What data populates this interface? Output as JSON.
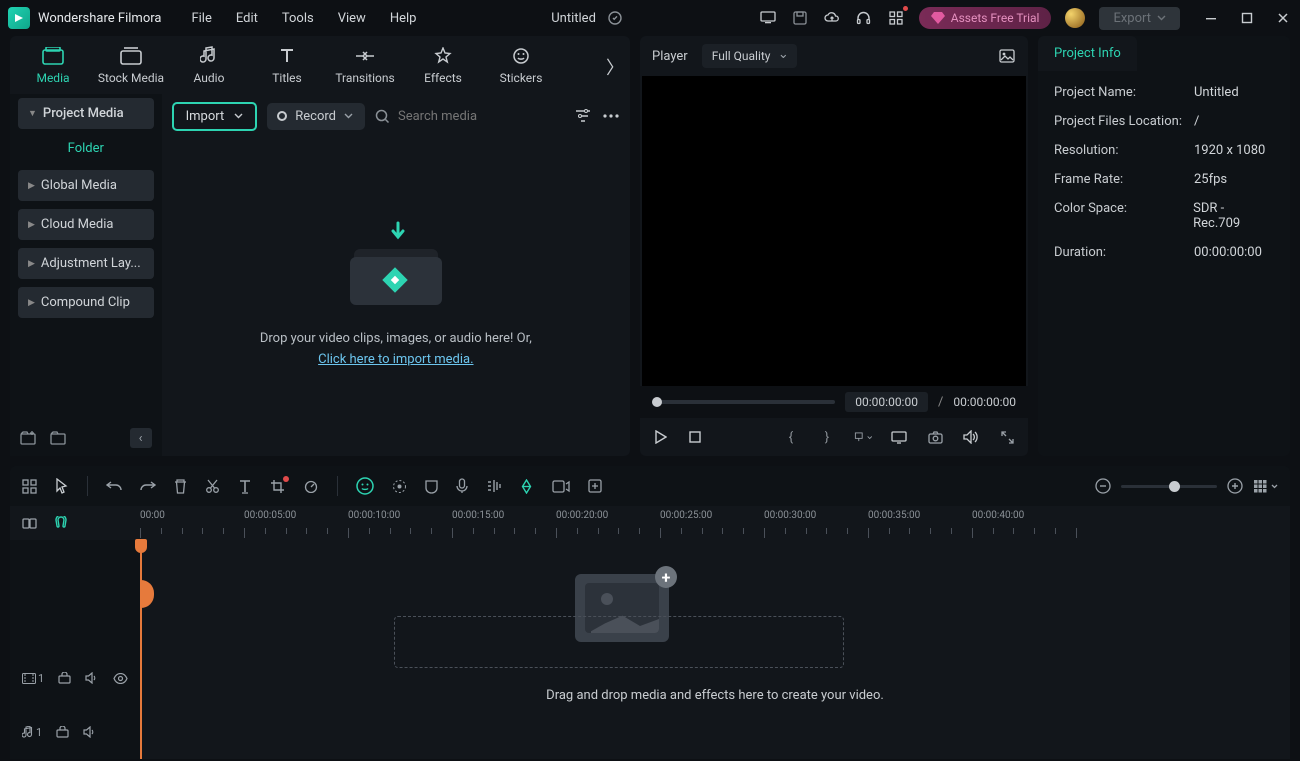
{
  "app": {
    "name": "Wondershare Filmora",
    "docTitle": "Untitled"
  },
  "menu": {
    "file": "File",
    "edit": "Edit",
    "tools": "Tools",
    "view": "View",
    "help": "Help"
  },
  "header": {
    "assets": "Assets Free Trial",
    "export": "Export"
  },
  "tabs": {
    "media": "Media",
    "stock": "Stock Media",
    "audio": "Audio",
    "titles": "Titles",
    "transitions": "Transitions",
    "effects": "Effects",
    "stickers": "Stickers"
  },
  "sidebar": {
    "projectMedia": "Project Media",
    "folder": "Folder",
    "items": [
      "Global Media",
      "Cloud Media",
      "Adjustment Lay...",
      "Compound Clip"
    ]
  },
  "mediaToolbar": {
    "import": "Import",
    "record": "Record",
    "searchPlaceholder": "Search media"
  },
  "dropzone": {
    "line1": "Drop your video clips, images, or audio here! Or,",
    "link": "Click here to import media."
  },
  "player": {
    "label": "Player",
    "quality": "Full Quality",
    "current": "00:00:00:00",
    "sep": "/",
    "total": "00:00:00:00"
  },
  "projectInfo": {
    "tab": "Project Info",
    "rows": [
      {
        "label": "Project Name:",
        "value": "Untitled"
      },
      {
        "label": "Project Files Location:",
        "value": "/"
      },
      {
        "label": "Resolution:",
        "value": "1920 x 1080"
      },
      {
        "label": "Frame Rate:",
        "value": "25fps"
      },
      {
        "label": "Color Space:",
        "value": "SDR - Rec.709"
      },
      {
        "label": "Duration:",
        "value": "00:00:00:00"
      }
    ]
  },
  "timeline": {
    "ruler": [
      "00:00",
      "00:00:05:00",
      "00:00:10:00",
      "00:00:15:00",
      "00:00:20:00",
      "00:00:25:00",
      "00:00:30:00",
      "00:00:35:00",
      "00:00:40:00"
    ],
    "dropHint": "Drag and drop media and effects here to create your video.",
    "videoTrack": "1",
    "audioTrack": "1"
  }
}
